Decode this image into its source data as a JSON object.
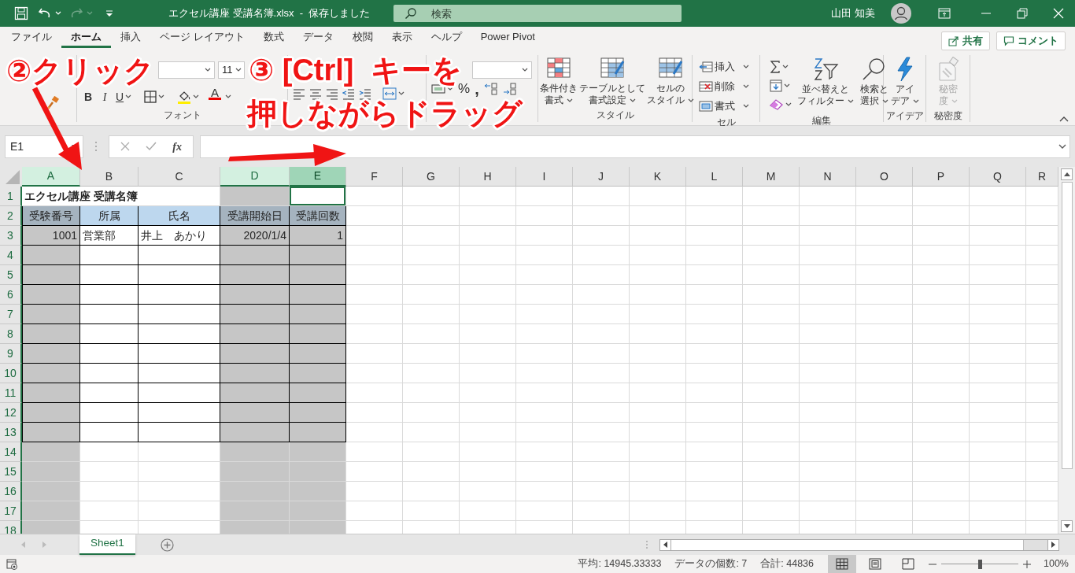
{
  "title_bar": {
    "title": "エクセル講座 受講名簿.xlsx  -  保存しました",
    "search": {
      "placeholder": "検索"
    },
    "user": "山田 知美",
    "redo_disabled": true
  },
  "tabs": [
    {
      "label": "ファイル",
      "selected": false
    },
    {
      "label": "ホーム",
      "selected": true
    },
    {
      "label": "挿入",
      "selected": false
    },
    {
      "label": "ページ レイアウト",
      "selected": false
    },
    {
      "label": "数式",
      "selected": false
    },
    {
      "label": "データ",
      "selected": false
    },
    {
      "label": "校閲",
      "selected": false
    },
    {
      "label": "表示",
      "selected": false
    },
    {
      "label": "ヘルプ",
      "selected": false
    },
    {
      "label": "Power Pivot",
      "selected": false
    }
  ],
  "share_button": "共有",
  "comment_button": "コメント",
  "ribbon": {
    "font": {
      "size": "11",
      "bold": "B",
      "italic": "I",
      "underline": "U",
      "font_color_letter": "A",
      "label": "フォント"
    },
    "number": {
      "percent": "%",
      "comma": ","
    },
    "styles": {
      "buttons": [
        {
          "lines": [
            "条件付き",
            "書式"
          ]
        },
        {
          "lines": [
            "テーブルとして",
            "書式設定"
          ]
        },
        {
          "lines": [
            "セルの",
            "スタイル"
          ]
        }
      ],
      "label": "スタイル"
    },
    "cells": {
      "buttons": [
        "挿入",
        "削除",
        "書式"
      ],
      "label": "セル"
    },
    "editing": {
      "buttons": [
        {
          "lines": [
            "並べ替えと",
            "フィルター"
          ]
        },
        {
          "lines": [
            "検索と",
            "選択"
          ]
        }
      ],
      "label": "編集"
    },
    "ideas": {
      "lines": [
        "アイ",
        "デア"
      ],
      "label": "アイデア"
    },
    "sensitivity": {
      "lines": [
        "秘密",
        "度"
      ],
      "disabled": true,
      "label": "秘密度"
    }
  },
  "annotations": [
    {
      "text": "②クリック"
    },
    {
      "text": "③ [Ctrl]  キーを"
    },
    {
      "text": "押しながらドラッグ"
    }
  ],
  "formula_bar": {
    "name_box": "E1",
    "fx": "fx"
  },
  "sheet": {
    "columns": [
      {
        "label": "A",
        "selected": true,
        "active": false
      },
      {
        "label": "B",
        "selected": false,
        "active": false
      },
      {
        "label": "C",
        "selected": false,
        "active": false
      },
      {
        "label": "D",
        "selected": true,
        "active": false
      },
      {
        "label": "E",
        "selected": true,
        "active": true
      },
      {
        "label": "F",
        "selected": false,
        "active": false
      },
      {
        "label": "G",
        "selected": false,
        "active": false
      },
      {
        "label": "H",
        "selected": false,
        "active": false
      },
      {
        "label": "I",
        "selected": false,
        "active": false
      },
      {
        "label": "J",
        "selected": false,
        "active": false
      },
      {
        "label": "K",
        "selected": false,
        "active": false
      },
      {
        "label": "L",
        "selected": false,
        "active": false
      },
      {
        "label": "M",
        "selected": false,
        "active": false
      },
      {
        "label": "N",
        "selected": false,
        "active": false
      },
      {
        "label": "O",
        "selected": false,
        "active": false
      },
      {
        "label": "P",
        "selected": false,
        "active": false
      },
      {
        "label": "Q",
        "selected": false,
        "active": false
      },
      {
        "label": "R",
        "selected": false,
        "active": false
      }
    ],
    "rows": [
      {
        "label": "1",
        "bordered": false,
        "cells": [
          {
            "text": "エクセル講座 受講名簿",
            "kind": "title"
          }
        ]
      },
      {
        "label": "2",
        "bordered": true,
        "cells": [
          {
            "text": "受験番号",
            "kind": "header"
          },
          {
            "text": "所属",
            "kind": "header"
          },
          {
            "text": "氏名",
            "kind": "header"
          },
          {
            "text": "受講開始日",
            "kind": "header"
          },
          {
            "text": "受講回数",
            "kind": "header"
          }
        ]
      },
      {
        "label": "3",
        "bordered": true,
        "cells": [
          {
            "text": "1001",
            "kind": "number"
          },
          {
            "text": "営業部",
            "kind": "text"
          },
          {
            "text": "井上　あかり",
            "kind": "text"
          },
          {
            "text": "2020/1/4",
            "kind": "number"
          },
          {
            "text": "1",
            "kind": "number"
          }
        ]
      },
      {
        "label": "4",
        "bordered": true
      },
      {
        "label": "5",
        "bordered": true
      },
      {
        "label": "6",
        "bordered": true
      },
      {
        "label": "7",
        "bordered": true
      },
      {
        "label": "8",
        "bordered": true
      },
      {
        "label": "9",
        "bordered": true
      },
      {
        "label": "10",
        "bordered": true
      },
      {
        "label": "11",
        "bordered": true
      },
      {
        "label": "12",
        "bordered": true
      },
      {
        "label": "13",
        "bordered": true
      },
      {
        "label": "14",
        "bordered": false
      },
      {
        "label": "15",
        "bordered": false
      },
      {
        "label": "16",
        "bordered": false
      },
      {
        "label": "17",
        "bordered": false
      },
      {
        "label": "18",
        "bordered": false
      }
    ]
  },
  "sheet_tabs": [
    {
      "label": "Sheet1",
      "selected": true
    }
  ],
  "status_bar": {
    "average": "平均: 14945.33333",
    "count": "データの個数: 7",
    "sum": "合計: 44836",
    "views": [
      {
        "selected": true
      },
      {
        "selected": false
      },
      {
        "selected": false
      }
    ],
    "zoom": {
      "level": 0.5,
      "reading": "100%"
    }
  }
}
